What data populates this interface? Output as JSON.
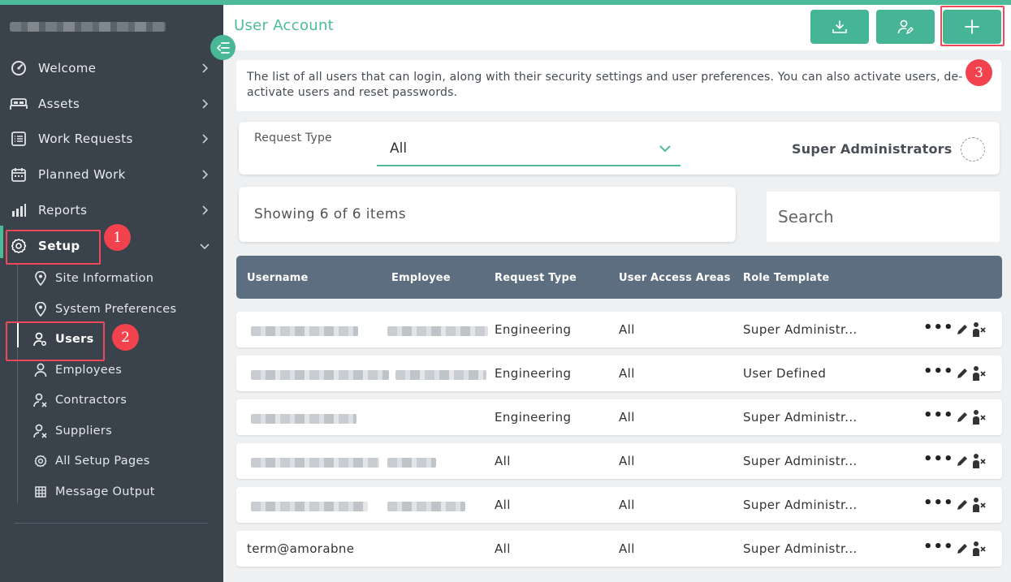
{
  "header": {
    "title": "User Account"
  },
  "sidebar": {
    "items": [
      {
        "label": "Welcome",
        "icon": "gauge-icon"
      },
      {
        "label": "Assets",
        "icon": "bed-icon"
      },
      {
        "label": "Work Requests",
        "icon": "list-icon"
      },
      {
        "label": "Planned Work",
        "icon": "calendar-icon"
      },
      {
        "label": "Reports",
        "icon": "bar-chart-icon"
      },
      {
        "label": "Setup",
        "icon": "gear-icon",
        "expanded": true
      }
    ],
    "setup_children": [
      {
        "label": "Site Information",
        "icon": "location-pin-icon"
      },
      {
        "label": "System Preferences",
        "icon": "location-pin-icon"
      },
      {
        "label": "Users",
        "icon": "user-key-icon",
        "active": true
      },
      {
        "label": "Employees",
        "icon": "user-icon"
      },
      {
        "label": "Contractors",
        "icon": "user-tools-icon"
      },
      {
        "label": "Suppliers",
        "icon": "user-tools-icon"
      },
      {
        "label": "All Setup Pages",
        "icon": "gear-icon"
      },
      {
        "label": "Message Output",
        "icon": "grid-icon"
      }
    ]
  },
  "annotations": {
    "step1": "1",
    "step2": "2",
    "step3": "3"
  },
  "description": "The list of all users that can login, along with their security settings and user preferences. You can also activate users, de-activate users and reset passwords.",
  "filter": {
    "request_type_label": "Request Type",
    "request_type_value": "All",
    "super_admin_label": "Super Administrators"
  },
  "count_text": "Showing 6 of 6 items",
  "search": {
    "placeholder": "Search"
  },
  "table": {
    "columns": [
      "Username",
      "Employee",
      "Request Type",
      "User Access Areas",
      "Role Template"
    ],
    "rows": [
      {
        "username": "",
        "employee": "",
        "request_type": "Engineering",
        "access_areas": "All",
        "role_template": "Super Administr..."
      },
      {
        "username": "",
        "employee": "",
        "request_type": "Engineering",
        "access_areas": "All",
        "role_template": "User Defined"
      },
      {
        "username": "",
        "employee": "",
        "request_type": "Engineering",
        "access_areas": "All",
        "role_template": "Super Administr..."
      },
      {
        "username": "",
        "employee": "",
        "request_type": "All",
        "access_areas": "All",
        "role_template": "Super Administr..."
      },
      {
        "username": "",
        "employee": "",
        "request_type": "All",
        "access_areas": "All",
        "role_template": "Super Administr..."
      },
      {
        "username": "term@amorabne",
        "employee": "",
        "request_type": "All",
        "access_areas": "All",
        "role_template": "Super Administr..."
      }
    ],
    "actions_more": "•••"
  },
  "colors": {
    "accent": "#4dbb9a",
    "sidebar_bg": "#3a434c",
    "table_header": "#5c6e80",
    "callout": "#f04a5a"
  }
}
